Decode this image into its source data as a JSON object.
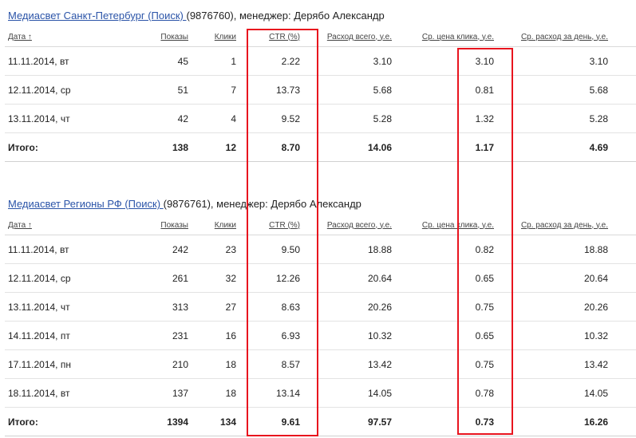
{
  "campaigns": [
    {
      "link": "Медиасвет Санкт-Петербург (Поиск) ",
      "rest": "(9876760), менеджер: Дерябо Александр",
      "rows": [
        [
          "11.11.2014, вт",
          "45",
          "1",
          "2.22",
          "3.10",
          "3.10",
          "3.10"
        ],
        [
          "12.11.2014, ср",
          "51",
          "7",
          "13.73",
          "5.68",
          "0.81",
          "5.68"
        ],
        [
          "13.11.2014, чт",
          "42",
          "4",
          "9.52",
          "5.28",
          "1.32",
          "5.28"
        ]
      ],
      "total": [
        "Итого:",
        "138",
        "12",
        "8.70",
        "14.06",
        "1.17",
        "4.69"
      ]
    },
    {
      "link": "Медиасвет Регионы РФ (Поиск) ",
      "rest": "(9876761), менеджер: Дерябо Александр",
      "rows": [
        [
          "11.11.2014, вт",
          "242",
          "23",
          "9.50",
          "18.88",
          "0.82",
          "18.88"
        ],
        [
          "12.11.2014, ср",
          "261",
          "32",
          "12.26",
          "20.64",
          "0.65",
          "20.64"
        ],
        [
          "13.11.2014, чт",
          "313",
          "27",
          "8.63",
          "20.26",
          "0.75",
          "20.26"
        ],
        [
          "14.11.2014, пт",
          "231",
          "16",
          "6.93",
          "10.32",
          "0.65",
          "10.32"
        ],
        [
          "17.11.2014, пн",
          "210",
          "18",
          "8.57",
          "13.42",
          "0.75",
          "13.42"
        ],
        [
          "18.11.2014, вт",
          "137",
          "18",
          "13.14",
          "14.05",
          "0.78",
          "14.05"
        ]
      ],
      "total": [
        "Итого:",
        "1394",
        "134",
        "9.61",
        "97.57",
        "0.73",
        "16.26"
      ]
    }
  ],
  "headers": [
    "Дата ↑",
    "Показы",
    "Клики",
    "CTR (%)",
    "Расход всего, у.е.",
    "Ср. цена клика, у.е.",
    "Ср. расход за день, у.е."
  ],
  "header_keys": [
    "date",
    "shows",
    "clicks",
    "ctr",
    "spend-total",
    "avg-cpc",
    "avg-daily-spend"
  ],
  "highlight_color": "#e8141e"
}
